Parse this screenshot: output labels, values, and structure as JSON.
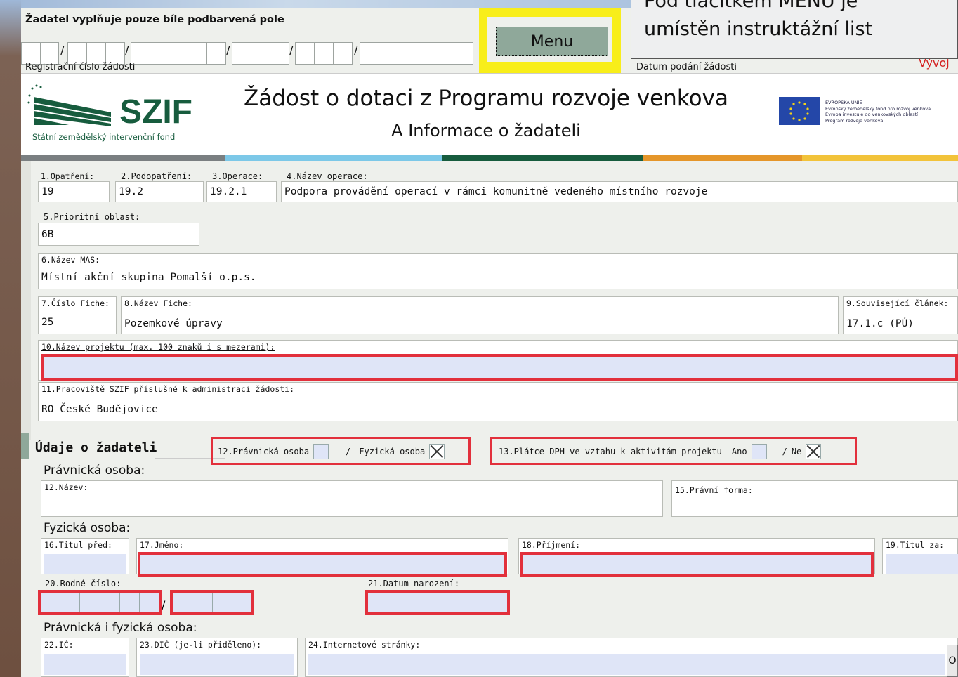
{
  "header": {
    "instruction": "Žadatel vyplňuje pouze bíle podbarvená pole",
    "reg_label": "Registrační číslo žádosti",
    "menu_button": "Menu",
    "date_label": "Datum podání žádosti",
    "right_red": "Vývoj",
    "tooltip_line1": "Pod tlačítkem MENU je",
    "tooltip_line2": "umístěn instruktážní list"
  },
  "banner": {
    "logo_text": "SZIF",
    "logo_caption": "Státní zemědělský intervenční fond",
    "title": "Žádost o dotaci z Programu rozvoje venkova",
    "subtitle": "A Informace o žadateli",
    "eu_line1": "EVROPSKÁ UNIE",
    "eu_line2": "Evropský zemědělský fond pro rozvoj venkova",
    "eu_line3": "Evropa investuje do venkovských oblastí",
    "eu_line4": "Program rozvoje venkova"
  },
  "colors": {
    "bar1": "#7a7f81",
    "bar2": "#7cc8e8",
    "bar3": "#175c3e",
    "bar4": "#e5962a",
    "bar5": "#f2c33a",
    "highlight": "#e2303c",
    "menu_outline": "#f8ee1a"
  },
  "form": {
    "f1": {
      "label": "1.Opatření:",
      "value": "19"
    },
    "f2": {
      "label": "2.Podopatření:",
      "value": "19.2"
    },
    "f3": {
      "label": "3.Operace:",
      "value": "19.2.1"
    },
    "f4": {
      "label": "4.Název operace:",
      "value": "Podpora provádění operací v rámci komunitně vedeného místního rozvoje"
    },
    "f5": {
      "label": "5.Prioritní oblast:",
      "value": "6B"
    },
    "f6": {
      "label": "6.Název MAS:",
      "value": "Místní akční skupina Pomalší o.p.s."
    },
    "f7": {
      "label": "7.Číslo Fiche:",
      "value": "25"
    },
    "f8": {
      "label": "8.Název Fiche:",
      "value": "Pozemkové úpravy"
    },
    "f9": {
      "label": "9.Související článek:",
      "value": "17.1.c (PÚ)"
    },
    "f10": {
      "label": "10.Název projektu (max. 100 znaků i s mezerami):"
    },
    "f11": {
      "label": "11.Pracoviště SZIF příslušné k administraci žádosti:",
      "value": "RO České Budějovice"
    }
  },
  "applicant": {
    "heading": "Údaje o žadateli",
    "legal_checkbox_label": "12.Právnická osoba",
    "natural_checkbox_label": "Fyzická osoba",
    "slash": "/",
    "vat_label": "13.Plátce DPH ve vztahu k aktivitám projektu",
    "vat_yes": "Ano",
    "vat_no": "Ne",
    "legal_heading": "Právnická osoba:",
    "name_label": "12.Název:",
    "form_label": "15.Právní forma:",
    "natural_heading": "Fyzická osoba:",
    "title_before": "16.Titul před:",
    "first_name": "17.Jméno:",
    "surname": "18.Příjmení:",
    "title_after": "19.Titul za:",
    "birth_no": "20.Rodné číslo:",
    "birth_date": "21.Datum narození:",
    "both_heading": "Právnická i fyzická osoba:",
    "ico": "22.IČ:",
    "dic": "23.DIČ (je-li přiděleno):",
    "web": "24.Internetové stránky:",
    "edge_char": "O"
  }
}
